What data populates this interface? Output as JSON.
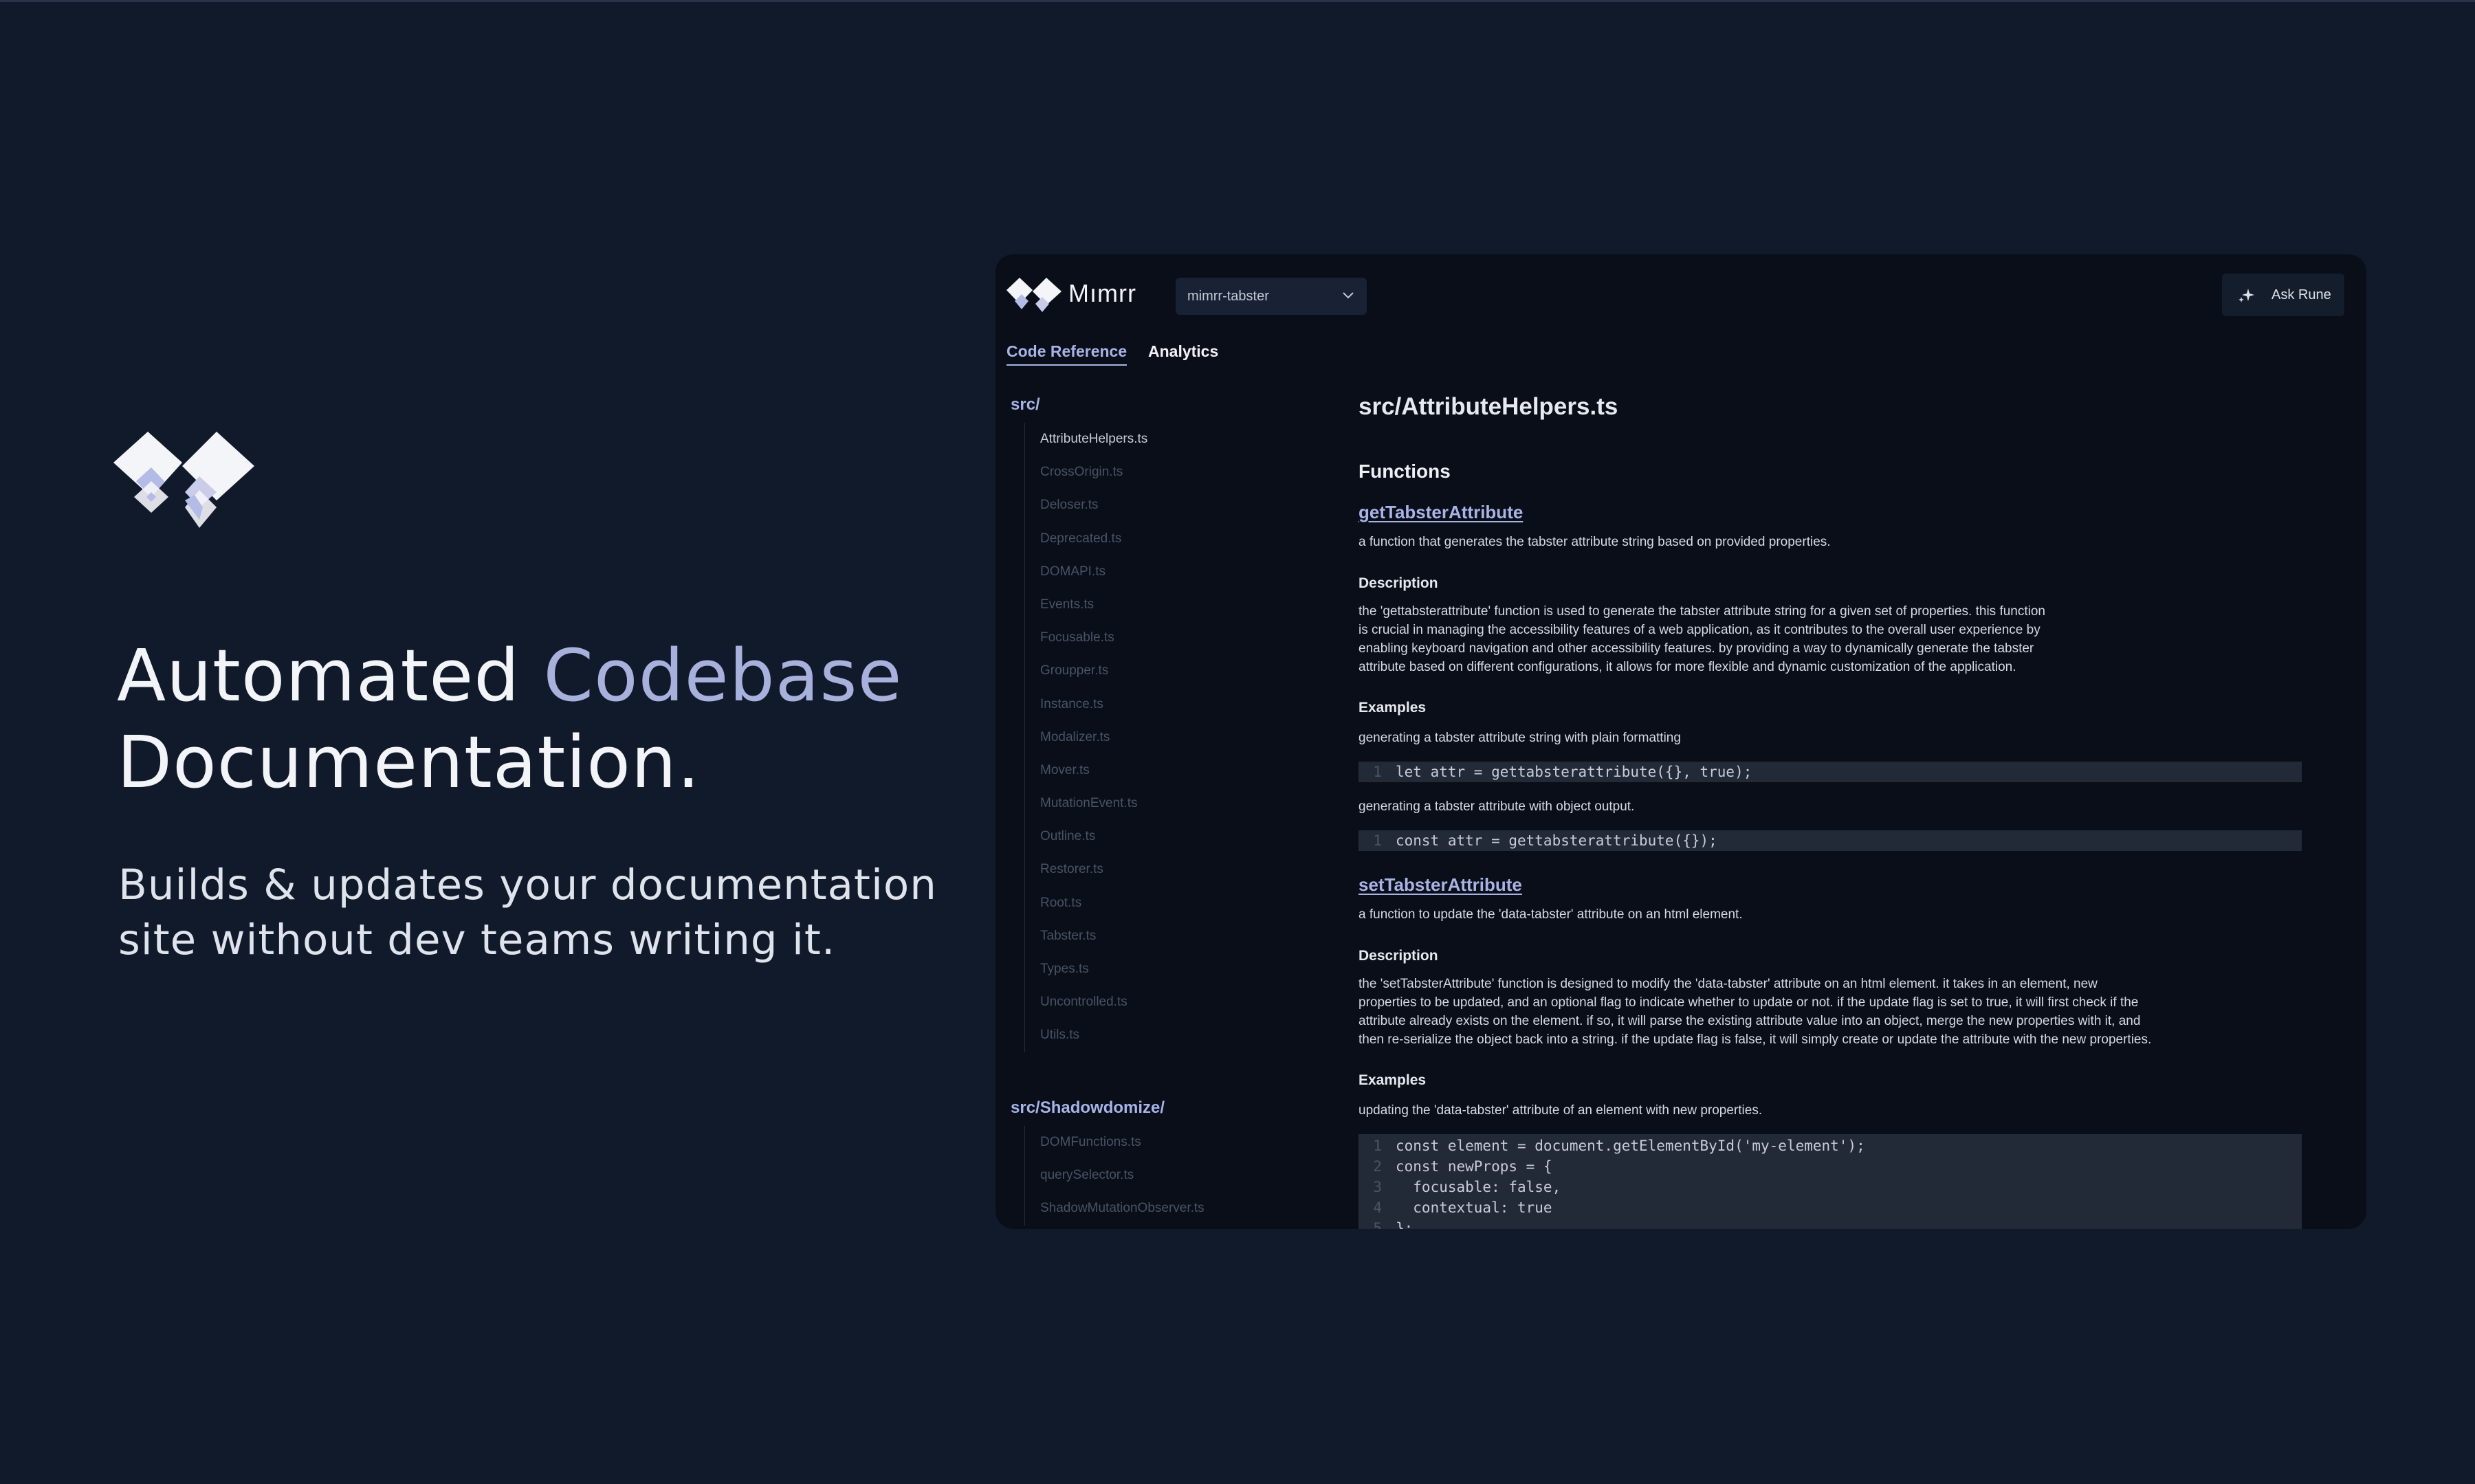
{
  "hero": {
    "title_part1": "Automated ",
    "title_accent": "Codebase",
    "title_part2": "Documentation.",
    "subtitle_line1": "Builds & updates your documentation",
    "subtitle_line2": "site without dev teams writing it."
  },
  "app": {
    "brand": "Mımrr",
    "repo_selected": "mimrr-tabster",
    "ask_button": "Ask Rune",
    "tabs": [
      "Code Reference",
      "Analytics"
    ],
    "sidebar": {
      "folders": [
        {
          "name": "src/",
          "files": [
            "AttributeHelpers.ts",
            "CrossOrigin.ts",
            "Deloser.ts",
            "Deprecated.ts",
            "DOMAPI.ts",
            "Events.ts",
            "Focusable.ts",
            "Groupper.ts",
            "Instance.ts",
            "Modalizer.ts",
            "Mover.ts",
            "MutationEvent.ts",
            "Outline.ts",
            "Restorer.ts",
            "Root.ts",
            "Tabster.ts",
            "Types.ts",
            "Uncontrolled.ts",
            "Utils.ts"
          ]
        },
        {
          "name": "src/Shadowdomize/",
          "files": [
            "DOMFunctions.ts",
            "querySelector.ts",
            "ShadowMutationObserver.ts"
          ]
        }
      ]
    },
    "content": {
      "title": "src/AttributeHelpers.ts",
      "functions_heading": "Functions",
      "description_heading": "Description",
      "examples_heading": "Examples",
      "functions": [
        {
          "name": "getTabsterAttribute",
          "summary": "a function that generates the tabster attribute string based on provided properties.",
          "description_lines": [
            "the 'gettabsterattribute' function is used to generate the tabster attribute string for a given set of properties. this function",
            "is crucial in managing the accessibility features of a web application, as it contributes to the overall user experience by",
            "enabling keyboard navigation and other accessibility features. by providing a way to dynamically generate the tabster",
            "attribute based on different configurations, it allows for more flexible and dynamic customization of the application."
          ],
          "example1_label": "generating a tabster attribute string with plain formatting",
          "example1_code": "let attr = gettabsterattribute({}, true);",
          "example2_label": "generating a tabster attribute with object output.",
          "example2_code": "const attr = gettabsterattribute({});"
        },
        {
          "name": "setTabsterAttribute",
          "summary": "a function to update the 'data-tabster' attribute on an html element.",
          "description_lines": [
            "the 'setTabsterAttribute' function is designed to modify the 'data-tabster' attribute on an html element. it takes in an element, new",
            "properties to be updated, and an optional flag to indicate whether to update or not. if the update flag is set to true, it will first check if the",
            "attribute already exists on the element. if so, it will parse the existing attribute value into an object, merge the new properties with it, and",
            "then re-serialize the object back into a string. if the update flag is false, it will simply create or update the attribute with the new properties."
          ],
          "example1_label": "updating the 'data-tabster' attribute of an element with new properties.",
          "code_lines": [
            "const element = document.getElementById('my-element');",
            "const newProps = {",
            "  focusable: false,",
            "  contextual: true",
            "};"
          ]
        }
      ]
    }
  },
  "colors": {
    "background": "#111a2b",
    "panel": "#090e19",
    "accent": "#a8b3e6",
    "code_bg": "#222a38"
  }
}
